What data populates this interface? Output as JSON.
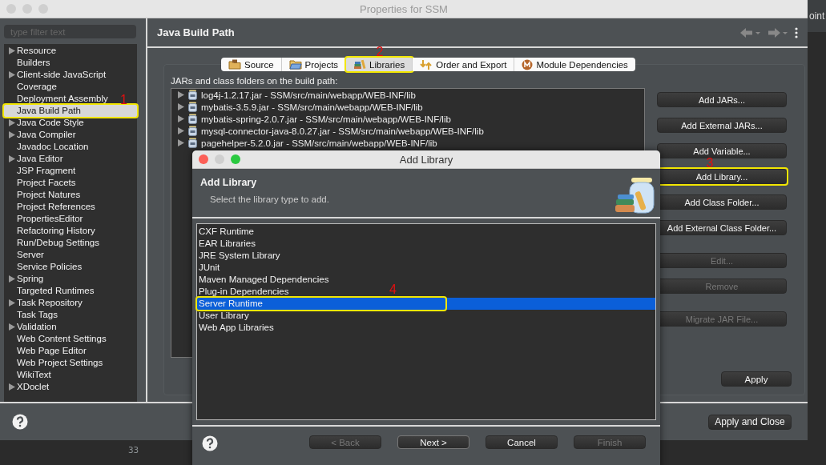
{
  "window": {
    "title": "Properties for SSM"
  },
  "filter": {
    "placeholder": "type filter text"
  },
  "sidebar": {
    "items": [
      {
        "label": "Resource",
        "expandable": true,
        "selected": false,
        "highlighted": false
      },
      {
        "label": "Builders",
        "expandable": false,
        "selected": false,
        "highlighted": false
      },
      {
        "label": "Client-side JavaScript",
        "expandable": true,
        "selected": false,
        "highlighted": false
      },
      {
        "label": "Coverage",
        "expandable": false,
        "selected": false,
        "highlighted": false
      },
      {
        "label": "Deployment Assembly",
        "expandable": false,
        "selected": false,
        "highlighted": false
      },
      {
        "label": "Java Build Path",
        "expandable": false,
        "selected": true,
        "highlighted": true,
        "marker": "1"
      },
      {
        "label": "Java Code Style",
        "expandable": true,
        "selected": false,
        "highlighted": false
      },
      {
        "label": "Java Compiler",
        "expandable": true,
        "selected": false,
        "highlighted": false
      },
      {
        "label": "Javadoc Location",
        "expandable": false,
        "selected": false,
        "highlighted": false
      },
      {
        "label": "Java Editor",
        "expandable": true,
        "selected": false,
        "highlighted": false
      },
      {
        "label": "JSP Fragment",
        "expandable": false,
        "selected": false,
        "highlighted": false
      },
      {
        "label": "Project Facets",
        "expandable": false,
        "selected": false,
        "highlighted": false
      },
      {
        "label": "Project Natures",
        "expandable": false,
        "selected": false,
        "highlighted": false
      },
      {
        "label": "Project References",
        "expandable": false,
        "selected": false,
        "highlighted": false
      },
      {
        "label": "PropertiesEditor",
        "expandable": false,
        "selected": false,
        "highlighted": false
      },
      {
        "label": "Refactoring History",
        "expandable": false,
        "selected": false,
        "highlighted": false
      },
      {
        "label": "Run/Debug Settings",
        "expandable": false,
        "selected": false,
        "highlighted": false
      },
      {
        "label": "Server",
        "expandable": false,
        "selected": false,
        "highlighted": false
      },
      {
        "label": "Service Policies",
        "expandable": false,
        "selected": false,
        "highlighted": false
      },
      {
        "label": "Spring",
        "expandable": true,
        "selected": false,
        "highlighted": false
      },
      {
        "label": "Targeted Runtimes",
        "expandable": false,
        "selected": false,
        "highlighted": false
      },
      {
        "label": "Task Repository",
        "expandable": true,
        "selected": false,
        "highlighted": false
      },
      {
        "label": "Task Tags",
        "expandable": false,
        "selected": false,
        "highlighted": false
      },
      {
        "label": "Validation",
        "expandable": true,
        "selected": false,
        "highlighted": false
      },
      {
        "label": "Web Content Settings",
        "expandable": false,
        "selected": false,
        "highlighted": false
      },
      {
        "label": "Web Page Editor",
        "expandable": false,
        "selected": false,
        "highlighted": false
      },
      {
        "label": "Web Project Settings",
        "expandable": false,
        "selected": false,
        "highlighted": false
      },
      {
        "label": "WikiText",
        "expandable": false,
        "selected": false,
        "highlighted": false
      },
      {
        "label": "XDoclet",
        "expandable": true,
        "selected": false,
        "highlighted": false
      }
    ]
  },
  "page": {
    "title": "Java Build Path",
    "tabs": [
      {
        "label": "Source",
        "kind": "source",
        "selected": false,
        "highlighted": false
      },
      {
        "label": "Projects",
        "kind": "projects",
        "selected": false,
        "highlighted": false
      },
      {
        "label": "Libraries",
        "kind": "libraries",
        "selected": true,
        "highlighted": true,
        "marker": "2"
      },
      {
        "label": "Order and Export",
        "kind": "order",
        "selected": false,
        "highlighted": false
      },
      {
        "label": "Module Dependencies",
        "kind": "module",
        "selected": false,
        "highlighted": false
      }
    ],
    "list_label": "JARs and class folders on the build path:",
    "entries": [
      {
        "label": "log4j-1.2.17.jar - SSM/src/main/webapp/WEB-INF/lib"
      },
      {
        "label": "mybatis-3.5.9.jar - SSM/src/main/webapp/WEB-INF/lib"
      },
      {
        "label": "mybatis-spring-2.0.7.jar - SSM/src/main/webapp/WEB-INF/lib"
      },
      {
        "label": "mysql-connector-java-8.0.27.jar - SSM/src/main/webapp/WEB-INF/lib"
      },
      {
        "label": "pagehelper-5.2.0.jar - SSM/src/main/webapp/WEB-INF/lib"
      }
    ],
    "button_groups": [
      [
        {
          "label": "Add JARs...",
          "disabled": false,
          "highlighted": false
        },
        {
          "label": "Add External JARs...",
          "disabled": false,
          "highlighted": false
        },
        {
          "label": "Add Variable...",
          "disabled": false,
          "highlighted": false
        },
        {
          "label": "Add Library...",
          "disabled": false,
          "highlighted": true,
          "marker": "3"
        },
        {
          "label": "Add Class Folder...",
          "disabled": false,
          "highlighted": false
        },
        {
          "label": "Add External Class Folder...",
          "disabled": false,
          "highlighted": false
        }
      ],
      [
        {
          "label": "Edit...",
          "disabled": true,
          "highlighted": false
        },
        {
          "label": "Remove",
          "disabled": true,
          "highlighted": false
        }
      ],
      [
        {
          "label": "Migrate JAR File...",
          "disabled": true,
          "highlighted": false
        }
      ]
    ],
    "apply": "Apply"
  },
  "footer": {
    "button": "Apply and Close"
  },
  "dialog": {
    "title": "Add Library",
    "heading": "Add Library",
    "description": "Select the library type to add.",
    "items": [
      {
        "label": "CXF Runtime",
        "selected": false,
        "highlighted": false
      },
      {
        "label": "EAR Libraries",
        "selected": false,
        "highlighted": false
      },
      {
        "label": "JRE System Library",
        "selected": false,
        "highlighted": false
      },
      {
        "label": "JUnit",
        "selected": false,
        "highlighted": false
      },
      {
        "label": "Maven Managed Dependencies",
        "selected": false,
        "highlighted": false
      },
      {
        "label": "Plug-in Dependencies",
        "selected": false,
        "highlighted": false
      },
      {
        "label": "Server Runtime",
        "selected": true,
        "highlighted": true,
        "marker": "4"
      },
      {
        "label": "User Library",
        "selected": false,
        "highlighted": false
      },
      {
        "label": "Web App Libraries",
        "selected": false,
        "highlighted": false
      }
    ],
    "buttons": [
      {
        "label": "< Back",
        "disabled": true,
        "default": false
      },
      {
        "label": "Next >",
        "disabled": false,
        "default": true
      },
      {
        "label": "Cancel",
        "disabled": false,
        "default": false
      },
      {
        "label": "Finish",
        "disabled": true,
        "default": false
      }
    ]
  },
  "background": {
    "tab_text": "oint",
    "line_number": "33"
  }
}
